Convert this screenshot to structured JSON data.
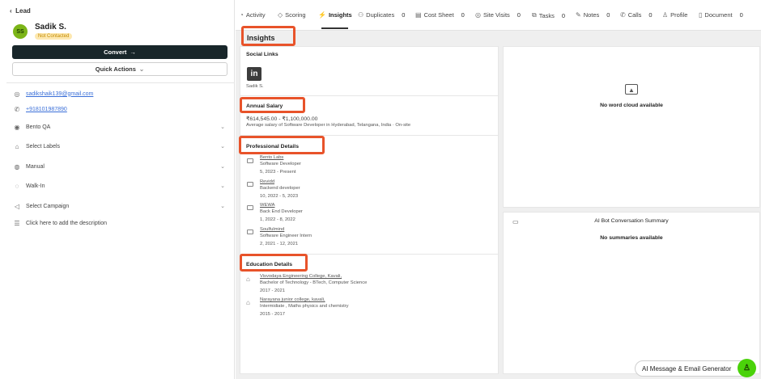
{
  "lead": {
    "back_label": "Lead",
    "initials": "SS",
    "name": "Sadik S.",
    "status": "Not Contacted",
    "convert_label": "Convert",
    "quick_actions_label": "Quick Actions"
  },
  "contact": {
    "email": "sadikshaik139@gmail.com",
    "phone": "+918101987890"
  },
  "fields": [
    {
      "label": "Bento QA",
      "icon": "user-circle-icon"
    },
    {
      "label": "Select Labels",
      "icon": "tag-icon"
    },
    {
      "label": "Manual",
      "icon": "source-icon"
    },
    {
      "label": "Walk-In",
      "icon": "walk-in-icon"
    },
    {
      "label": "Select Campaign",
      "icon": "megaphone-icon"
    }
  ],
  "description_placeholder": "Click here to add the description",
  "tabs": [
    {
      "label": "Activity",
      "count": ""
    },
    {
      "label": "Scoring",
      "count": ""
    },
    {
      "label": "Insights",
      "count": ""
    },
    {
      "label": "Duplicates",
      "count": "0"
    },
    {
      "label": "Cost Sheet",
      "count": "0"
    },
    {
      "label": "Site Visits",
      "count": "0"
    },
    {
      "label": "Tasks",
      "count": "0"
    },
    {
      "label": "Notes",
      "count": "0"
    },
    {
      "label": "Calls",
      "count": "0"
    },
    {
      "label": "Profile",
      "count": ""
    },
    {
      "label": "Document",
      "count": "0"
    }
  ],
  "insights": {
    "title": "Insights",
    "social_links_title": "Social Links",
    "social_name": "Sadik S.",
    "salary_title": "Annual Salary",
    "salary_range": "₹614,545.00 - ₹1,100,000.00",
    "salary_note": "Average salary of Software Developer in Hyderabad, Telangana, India · On-site",
    "professional_title": "Professional Details",
    "jobs": [
      {
        "company": "Bento Labs",
        "role": "Software Developer",
        "period": "5, 2023 - Present"
      },
      {
        "company": "Revidd",
        "role": "Backend developer",
        "period": "10, 2022 - 5, 2023"
      },
      {
        "company": "WEWA",
        "role": "Back End Developer",
        "period": "1, 2022 - 8, 2022"
      },
      {
        "company": "Soulfulmind",
        "role": "Software Engineer Intern",
        "period": "2, 2021 - 12, 2021"
      }
    ],
    "education_title": "Education Details",
    "education": [
      {
        "school": "Visvodaya Engineering College, Kavali,",
        "degree": "Bachelor of Technology - BTech, Computer Science",
        "period": "2017 - 2021"
      },
      {
        "school": "Narayana junior college, kavali,",
        "degree": "Intermidiate , Maths physics and chemistry",
        "period": "2015 - 2017"
      }
    ]
  },
  "word_cloud": {
    "empty_text": "No word cloud available"
  },
  "ai_summary": {
    "title": "AI Bot Conversation Summary",
    "empty_text": "No summaries available"
  },
  "ai_generator": {
    "label": "AI Message & Email Generator"
  },
  "colors": {
    "accent_dark": "#18262a",
    "highlight": "#e8532a",
    "green": "#4ad20a",
    "avatar": "#7cb518"
  }
}
